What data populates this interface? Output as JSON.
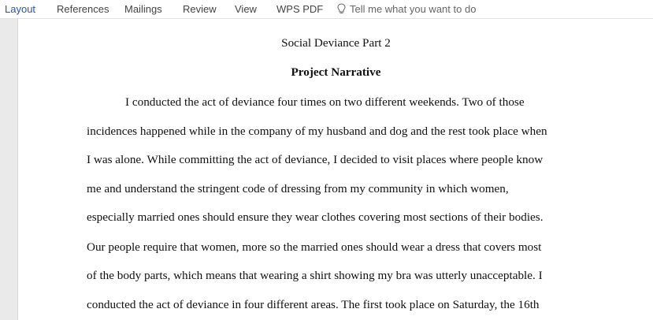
{
  "ribbon": {
    "tabs": [
      {
        "label": "Layout",
        "active": true
      },
      {
        "label": "References",
        "active": false
      },
      {
        "label": "Mailings",
        "active": false
      },
      {
        "label": "Review",
        "active": false
      },
      {
        "label": "View",
        "active": false
      },
      {
        "label": "WPS PDF",
        "active": false
      }
    ],
    "tell_me": "Tell me what you want to do"
  },
  "document": {
    "title": "Social Deviance Part 2",
    "heading": "Project Narrative",
    "lines": [
      "I conducted the act of deviance four times on two different weekends. Two of those",
      "incidences happened while in the company of my husband and dog and the rest took place when",
      "I was alone. While committing the act of deviance, I decided to visit places where people know",
      "me and understand the stringent code of dressing from my community in which women,",
      "especially married ones should ensure they wear clothes covering most sections of their bodies.",
      "Our people require that women, more so the married ones should wear a dress that covers most",
      "of the body parts, which means that wearing a shirt showing my bra was utterly unacceptable. I",
      "conducted the act of deviance in four different areas. The first took place on Saturday, the 16th"
    ]
  },
  "colors": {
    "active_tab": "#2b579a",
    "tab_text": "#444444",
    "page_background": "#ffffff",
    "workspace_background": "#eaeaea"
  }
}
